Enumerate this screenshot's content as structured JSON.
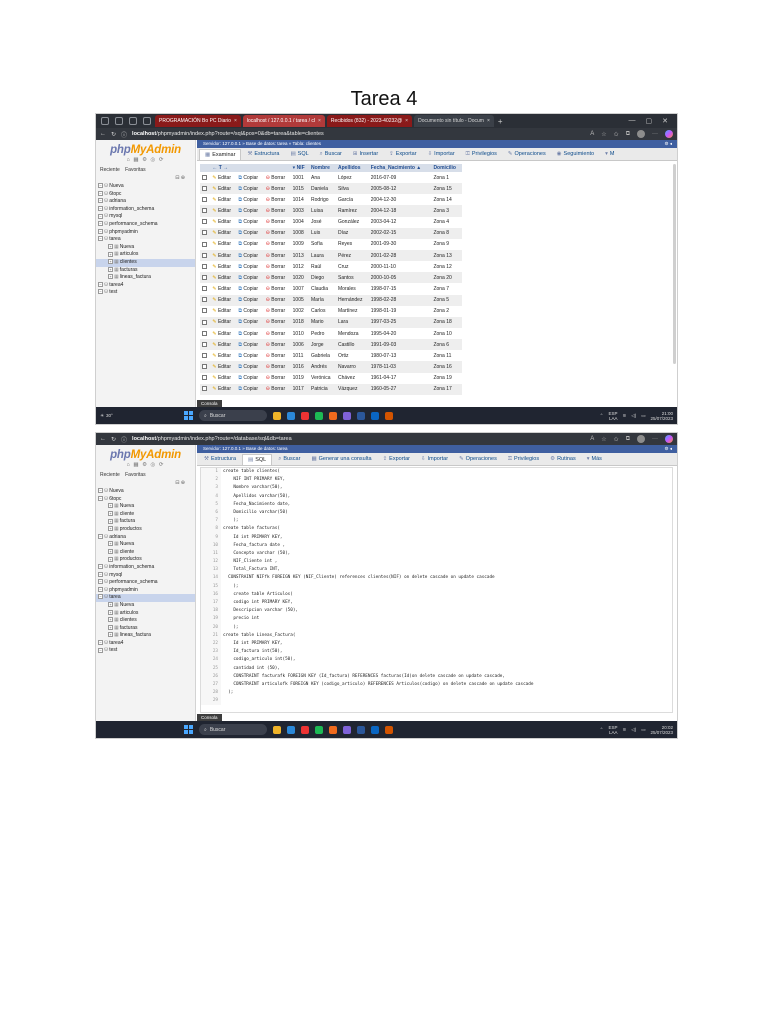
{
  "document": {
    "title": "Tarea 4"
  },
  "browser1": {
    "tabs": [
      {
        "label": "PROGRAMACIÓN Bo PC Diario"
      },
      {
        "label": "localhost / 127.0.0.1 / tarea / cl"
      },
      {
        "label": "Recibidos (832) - 2023-40232@"
      },
      {
        "label": "Documento sin título - Docum"
      }
    ],
    "url_host": "localhost",
    "url_path": "/phpmyadmin/index.php?route=/sql&pos=0&db=tarea&table=clientes"
  },
  "browser2": {
    "url_host": "localhost",
    "url_path": "/phpmyadmin/index.php?route=/database/sql&db=tarea"
  },
  "sidebar": {
    "logo_php": "php",
    "logo_myadmin": "MyAdmin",
    "logo_icons": "⌂ ▦ ⚙ ◎ ⟳",
    "recent": "Reciente",
    "favorites": "Favoritas",
    "collapse": "⊟ ⊕"
  },
  "sidebar1_tree": [
    {
      "label": "Nueva",
      "level": 0
    },
    {
      "label": "6topc",
      "level": 0
    },
    {
      "label": "adriana",
      "level": 0
    },
    {
      "label": "information_schema",
      "level": 0
    },
    {
      "label": "mysql",
      "level": 0
    },
    {
      "label": "performance_schema",
      "level": 0
    },
    {
      "label": "phpmyadmin",
      "level": 0
    },
    {
      "label": "tarea",
      "level": 0
    },
    {
      "label": "Nueva",
      "level": 1
    },
    {
      "label": "articulos",
      "level": 1
    },
    {
      "label": "clientes",
      "level": 1,
      "selected": true
    },
    {
      "label": "facturas",
      "level": 1
    },
    {
      "label": "lineas_factura",
      "level": 1
    },
    {
      "label": "tarea4",
      "level": 0
    },
    {
      "label": "test",
      "level": 0
    }
  ],
  "sidebar2_tree": [
    {
      "label": "Nueva",
      "level": 0
    },
    {
      "label": "6topc",
      "level": 0
    },
    {
      "label": "Nueva",
      "level": 1
    },
    {
      "label": "cliente",
      "level": 1
    },
    {
      "label": "factura",
      "level": 1
    },
    {
      "label": "productos",
      "level": 1
    },
    {
      "label": "adriana",
      "level": 0
    },
    {
      "label": "Nueva",
      "level": 1
    },
    {
      "label": "cliente",
      "level": 1
    },
    {
      "label": "productos",
      "level": 1
    },
    {
      "label": "information_schema",
      "level": 0
    },
    {
      "label": "mysql",
      "level": 0
    },
    {
      "label": "performance_schema",
      "level": 0
    },
    {
      "label": "phpmyadmin",
      "level": 0
    },
    {
      "label": "tarea",
      "level": 0,
      "selected": true
    },
    {
      "label": "Nueva",
      "level": 1
    },
    {
      "label": "articulos",
      "level": 1
    },
    {
      "label": "clientes",
      "level": 1
    },
    {
      "label": "facturas",
      "level": 1
    },
    {
      "label": "lineas_factura",
      "level": 1
    },
    {
      "label": "tarea4",
      "level": 0
    },
    {
      "label": "test",
      "level": 0
    }
  ],
  "breadcrumb1": "Servidor: 127.0.0.1 » Base de datos: tarea » Tabla: clientes",
  "breadcrumb2": "Servidor: 127.0.0.1 » Base de datos: tarea",
  "tabs1": [
    {
      "icon": "▦",
      "label": "Examinar",
      "active": true
    },
    {
      "icon": "⚒",
      "label": "Estructura"
    },
    {
      "icon": "▤",
      "label": "SQL"
    },
    {
      "icon": "⌕",
      "label": "Buscar"
    },
    {
      "icon": "⊞",
      "label": "Insertar"
    },
    {
      "icon": "⇪",
      "label": "Exportar"
    },
    {
      "icon": "⇩",
      "label": "Importar"
    },
    {
      "icon": "⚿",
      "label": "Privilegios"
    },
    {
      "icon": "✎",
      "label": "Operaciones"
    },
    {
      "icon": "◉",
      "label": "Seguimiento"
    },
    {
      "icon": "▾",
      "label": "M"
    }
  ],
  "tabs2": [
    {
      "icon": "⚒",
      "label": "Estructura"
    },
    {
      "icon": "▤",
      "label": "SQL",
      "active": true
    },
    {
      "icon": "⌕",
      "label": "Buscar"
    },
    {
      "icon": "▦",
      "label": "Generar una consulta"
    },
    {
      "icon": "⇪",
      "label": "Exportar"
    },
    {
      "icon": "⇩",
      "label": "Importar"
    },
    {
      "icon": "✎",
      "label": "Operaciones"
    },
    {
      "icon": "⚿",
      "label": "Privilegios"
    },
    {
      "icon": "⚙",
      "label": "Rutinas"
    },
    {
      "icon": "▾",
      "label": "Más"
    }
  ],
  "table": {
    "sort_arrows": "← T →",
    "headers": [
      "NIF",
      "Nombre",
      "Apellidos",
      "Fecha_Nacimiento",
      "Domicilio"
    ],
    "actions": {
      "edit": "Editar",
      "copy": "Copiar",
      "delete": "Borrar"
    },
    "rows": [
      [
        "1001",
        "Ana",
        "López",
        "2016-07-09",
        "Zona 1"
      ],
      [
        "1015",
        "Daniela",
        "Silva",
        "2005-08-12",
        "Zona 15"
      ],
      [
        "1014",
        "Rodrigo",
        "García",
        "2004-12-30",
        "Zona 14"
      ],
      [
        "1003",
        "Luisa",
        "Ramírez",
        "2004-12-18",
        "Zona 3"
      ],
      [
        "1004",
        "José",
        "González",
        "2003-04-12",
        "Zona 4"
      ],
      [
        "1008",
        "Luis",
        "Díaz",
        "2002-02-15",
        "Zona 8"
      ],
      [
        "1009",
        "Sofía",
        "Reyes",
        "2001-09-30",
        "Zona 9"
      ],
      [
        "1013",
        "Laura",
        "Pérez",
        "2001-02-28",
        "Zona 13"
      ],
      [
        "1012",
        "Raúl",
        "Cruz",
        "2000-11-10",
        "Zona 12"
      ],
      [
        "1020",
        "Diego",
        "Santos",
        "2000-10-05",
        "Zona 20"
      ],
      [
        "1007",
        "Claudia",
        "Morales",
        "1998-07-15",
        "Zona 7"
      ],
      [
        "1005",
        "María",
        "Hernández",
        "1998-02-28",
        "Zona 5"
      ],
      [
        "1002",
        "Carlos",
        "Martínez",
        "1998-01-19",
        "Zona 2"
      ],
      [
        "1018",
        "Mario",
        "Lara",
        "1997-03-25",
        "Zona 18"
      ],
      [
        "1010",
        "Pedro",
        "Mendoza",
        "1995-04-20",
        "Zona 10"
      ],
      [
        "1006",
        "Jorge",
        "Castillo",
        "1991-09-03",
        "Zona 6"
      ],
      [
        "1011",
        "Gabriela",
        "Ortiz",
        "1980-07-13",
        "Zona 11"
      ],
      [
        "1016",
        "Andrés",
        "Navarro",
        "1978-11-03",
        "Zona 16"
      ],
      [
        "1019",
        "Verónica",
        "Chávez",
        "1961-04-17",
        "Zona 19"
      ],
      [
        "1017",
        "Patricia",
        "Vázquez",
        "1960-05-27",
        "Zona 17"
      ]
    ]
  },
  "sql_lines": [
    {
      "n": "1",
      "t": "create table clientes("
    },
    {
      "n": "2",
      "t": "    NIF INT PRIMARY KEY,"
    },
    {
      "n": "3",
      "t": "    Nombre varchar(50),"
    },
    {
      "n": "4",
      "t": "    Apellidos varchar(50),"
    },
    {
      "n": "5",
      "t": "    Fecha_Nacimiento date,"
    },
    {
      "n": "6",
      "t": "    Domicilio varchar(50)"
    },
    {
      "n": "7",
      "t": "    );"
    },
    {
      "n": "8",
      "t": "create table facturas("
    },
    {
      "n": "9",
      "t": "    Id int PRIMARY KEY,"
    },
    {
      "n": "10",
      "t": "    Fecha_factura date ,"
    },
    {
      "n": "11",
      "t": "    Concepto varchar (50),"
    },
    {
      "n": "12",
      "t": "    NIF_Cliente int ,"
    },
    {
      "n": "13",
      "t": "    Total_Factura INT,"
    },
    {
      "n": "14",
      "t": "  CONSTRAINT NIFfk FOREIGN KEY (NIF_Cliente) references clientes(NIF) on delete cascade on update cascade"
    },
    {
      "n": "15",
      "t": "    );"
    },
    {
      "n": "16",
      "t": "    create table Articulos("
    },
    {
      "n": "17",
      "t": "    codigo int PRIMARY KEY,"
    },
    {
      "n": "18",
      "t": "    Descripcion varchar (50),"
    },
    {
      "n": "19",
      "t": "    precio int"
    },
    {
      "n": "20",
      "t": "    );"
    },
    {
      "n": "21",
      "t": "create table Lineas_Factura("
    },
    {
      "n": "22",
      "t": "    Id int PRIMARY KEY,"
    },
    {
      "n": "23",
      "t": "    Id_factura int(50),"
    },
    {
      "n": "24",
      "t": "    codigo_articulo int(50),"
    },
    {
      "n": "25",
      "t": "    cantidad int (50),"
    },
    {
      "n": "26",
      "t": "    CONSTRAINT facturafk FOREIGN KEY (Id_factura) REFERENCES facturas(Id)on delete cascade on update cascade,"
    },
    {
      "n": "27",
      "t": "    CONSTRAINT articulofk FOREIGN KEY (codigo_articulo) REFERENCES Articulos(codigo) on delete cascade on update cascade"
    },
    {
      "n": "28",
      "t": "  );"
    },
    {
      "n": "29",
      "t": ""
    }
  ],
  "console_label": "Consola",
  "taskbar": {
    "weather_temp": "30°",
    "search_label": "Buscar",
    "lang_top": "ESP",
    "lang_bottom": "LAA",
    "time1": "21:00",
    "date1": "25/07/2023",
    "time2": "20:02",
    "date2": "25/07/2023"
  },
  "colors": {
    "pma_blue": "#3f5fa0",
    "link_blue": "#1a4ea0",
    "header_bg": "#d7dee9",
    "sidebar_bg": "#f3f3f3",
    "taskbar_bg": "#202531"
  }
}
